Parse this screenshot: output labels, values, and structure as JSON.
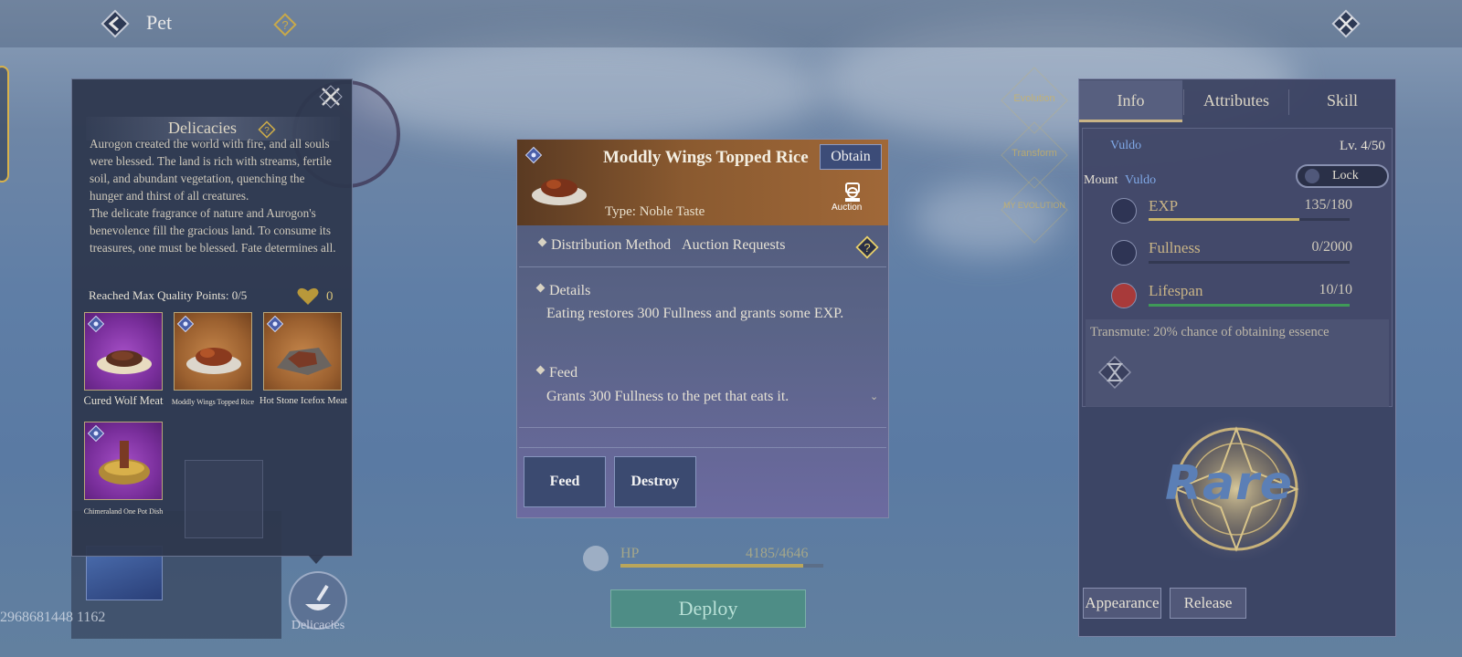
{
  "header": {
    "title": "Pet"
  },
  "player_id": "2968681448 1162",
  "delicacies_panel": {
    "title": "Delicacies",
    "description": "Aurogon created the world with fire, and all souls were blessed. The land is rich with streams, fertile soil, and abundant vegetation, quenching the hunger and thirst of all creatures.\nThe delicate fragrance of nature and Aurogon's benevolence fill the gracious land. To consume its treasures, one must be blessed. Fate determines all.",
    "quality_text": "Reached Max Quality Points: 0/5",
    "heart_count": "0",
    "foods": [
      {
        "label": "Cured Wolf Meat",
        "rarity": "purple"
      },
      {
        "label": "Moddly Wings Topped Rice",
        "rarity": "orange"
      },
      {
        "label": "Hot Stone Icefox Meat",
        "rarity": "orange"
      },
      {
        "label": "Chimeraland One Pot Dish",
        "rarity": "purple"
      }
    ],
    "tab_label": "Delicacies"
  },
  "item_card": {
    "name": "Moddly Wings Topped Rice",
    "obtain_label": "Obtain",
    "type": "Type: Noble Taste",
    "auction_label": "Auction",
    "distribution": "Distribution Method",
    "distribution_value": "Auction Requests",
    "details_title": "Details",
    "details_body": "Eating restores 300 Fullness and grants some EXP.",
    "feed_title": "Feed",
    "feed_body": "Grants 300 Fullness to the pet that eats it.",
    "feed_button": "Feed",
    "destroy_button": "Destroy"
  },
  "hp": {
    "label": "HP",
    "value": "4185/4646",
    "fraction": 0.9
  },
  "deploy_label": "Deploy",
  "side_skills": [
    "Evolution",
    "Transform",
    "MY EVOLUTION"
  ],
  "right_panel": {
    "tabs": [
      "Info",
      "Attributes",
      "Skill"
    ],
    "pet_name": "Vuldo",
    "level": "Lv. 4/50",
    "mount_label": "Mount",
    "mount_name": "Vuldo",
    "lock_label": "Lock",
    "stats": [
      {
        "label": "EXP",
        "value": "135/180",
        "fraction": 0.75,
        "color": "#c9b46a"
      },
      {
        "label": "Fullness",
        "value": "0/2000",
        "fraction": 0.0,
        "color": "#c9b46a"
      },
      {
        "label": "Lifespan",
        "value": "10/10",
        "fraction": 1.0,
        "color": "#3f9a58"
      }
    ],
    "transmute_text": "Transmute: 20% chance of obtaining essence",
    "rarity": "Rare",
    "appearance_button": "Appearance",
    "release_button": "Release"
  }
}
